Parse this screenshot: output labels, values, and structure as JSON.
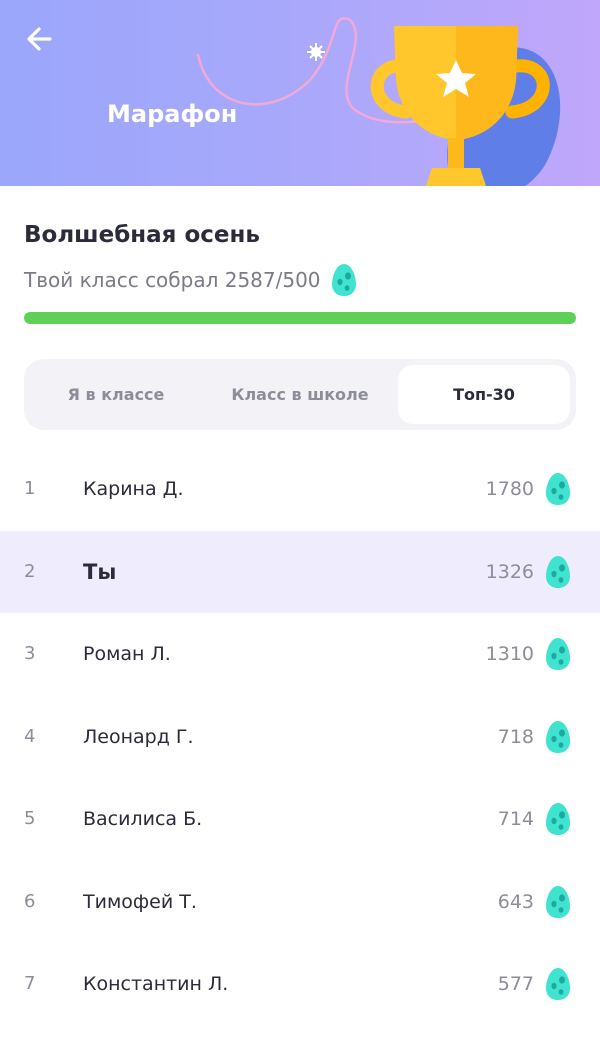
{
  "header": {
    "title": "Марафон",
    "back_icon": "arrow-left-icon",
    "trophy_icon": "trophy-icon"
  },
  "marathon": {
    "title": "Волшебная осень",
    "progress_text": "Твой класс собрал 2587/500",
    "progress_fraction": 1.0,
    "egg_icon": "egg-icon"
  },
  "tabs": [
    {
      "label": "Я в классе",
      "active": false
    },
    {
      "label": "Класс в школе",
      "active": false
    },
    {
      "label": "Топ-30",
      "active": true
    }
  ],
  "leaderboard": [
    {
      "rank": "1",
      "name": "Карина Д.",
      "score": "1780",
      "is_me": false
    },
    {
      "rank": "2",
      "name": "Ты",
      "score": "1326",
      "is_me": true
    },
    {
      "rank": "3",
      "name": "Роман Л.",
      "score": "1310",
      "is_me": false
    },
    {
      "rank": "4",
      "name": "Леонард Г.",
      "score": "718",
      "is_me": false
    },
    {
      "rank": "5",
      "name": "Василиса Б.",
      "score": "714",
      "is_me": false
    },
    {
      "rank": "6",
      "name": "Тимофей Т.",
      "score": "643",
      "is_me": false
    },
    {
      "rank": "7",
      "name": "Константин Л.",
      "score": "577",
      "is_me": false
    }
  ],
  "colors": {
    "progress": "#5dd055",
    "highlight_row": "#efedfd",
    "egg": "#3fe3cf",
    "trophy": "#ffc72c"
  }
}
